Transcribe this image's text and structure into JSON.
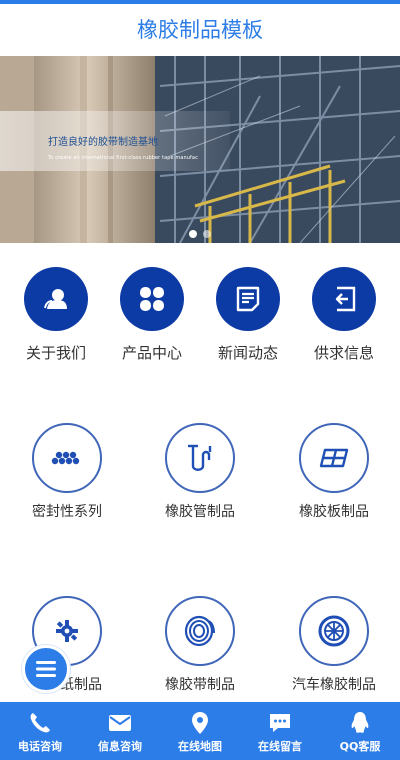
{
  "header": {
    "title": "橡胶制品模板"
  },
  "banner": {
    "title": "打造良好的胶带制造基地",
    "subtitle": "To create an international first-class rubber tape manufac",
    "slides": 2,
    "active_slide": 1
  },
  "nav": {
    "items": [
      {
        "label": "关于我们",
        "icon": "user-icon"
      },
      {
        "label": "产品中心",
        "icon": "grid-icon"
      },
      {
        "label": "新闻动态",
        "icon": "document-icon"
      },
      {
        "label": "供求信息",
        "icon": "exit-icon"
      }
    ]
  },
  "products": {
    "items": [
      {
        "label": "密封性系列",
        "icon": "seal-icon"
      },
      {
        "label": "橡胶管制品",
        "icon": "pipe-icon"
      },
      {
        "label": "橡胶板制品",
        "icon": "panel-icon"
      },
      {
        "label": "橡胶纸制品",
        "icon": "gear-icon"
      },
      {
        "label": "橡胶带制品",
        "icon": "belt-roll-icon"
      },
      {
        "label": "汽车橡胶制品",
        "icon": "wheel-icon"
      }
    ]
  },
  "bottom_nav": {
    "items": [
      {
        "label": "电话咨询",
        "icon": "phone-icon"
      },
      {
        "label": "信息咨询",
        "icon": "mail-icon"
      },
      {
        "label": "在线地图",
        "icon": "map-pin-icon"
      },
      {
        "label": "在线留言",
        "icon": "chat-icon"
      },
      {
        "label": "QQ客服",
        "icon": "qq-icon"
      }
    ]
  },
  "colors": {
    "brand": "#2d7de8",
    "nav_circle": "#0c3ba5",
    "icon_outline": "#3f66b8"
  }
}
